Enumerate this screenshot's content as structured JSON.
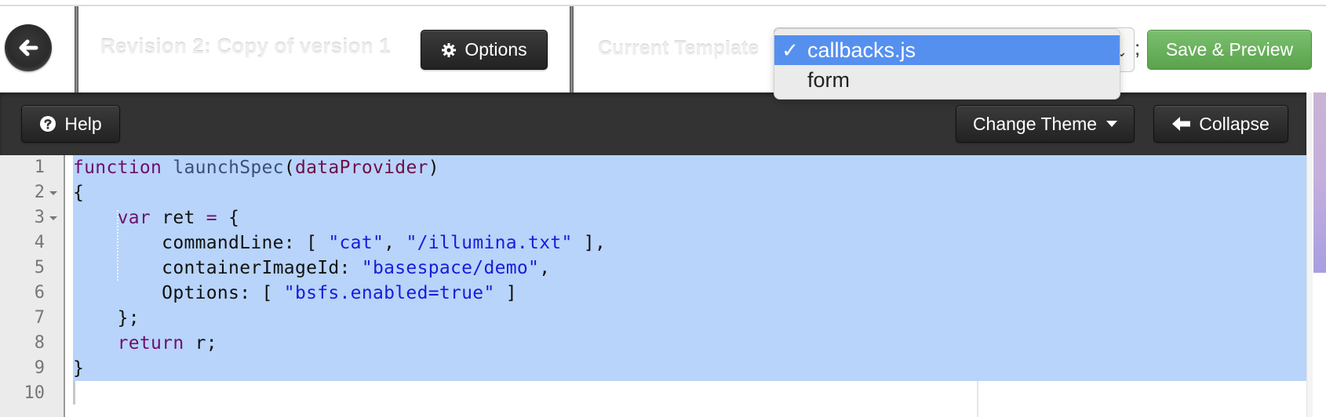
{
  "header": {
    "back_icon": "arrow-left-circle-icon",
    "title": "Revision 2: Copy of version 1",
    "options_label": "Options",
    "options_icon": "gear-icon",
    "template_label": "Current Template",
    "template_select": {
      "selected": "callbacks.js",
      "options": [
        "callbacks.js",
        "form"
      ],
      "check_glyph": "✓"
    },
    "separator": ";",
    "save_label": "Save & Preview"
  },
  "toolbar": {
    "help_label": "Help",
    "help_icon": "question-circle-icon",
    "theme_label": "Change Theme",
    "collapse_label": "Collapse",
    "collapse_icon": "arrow-left-icon"
  },
  "editor": {
    "line_numbers": [
      "1",
      "2",
      "3",
      "4",
      "5",
      "6",
      "7",
      "8",
      "9",
      "10"
    ],
    "foldable_lines": [
      2,
      3
    ],
    "selected_lines": "1-9",
    "lines": [
      [
        {
          "t": "kw",
          "v": "function"
        },
        {
          "t": "",
          "v": " "
        },
        {
          "t": "fn",
          "v": "launchSpec"
        },
        {
          "t": "",
          "v": "("
        },
        {
          "t": "param",
          "v": "dataProvider"
        },
        {
          "t": "",
          "v": ")"
        }
      ],
      [
        {
          "t": "",
          "v": "{"
        }
      ],
      [
        {
          "t": "",
          "v": "    "
        },
        {
          "t": "kw",
          "v": "var"
        },
        {
          "t": "",
          "v": " ret "
        },
        {
          "t": "op",
          "v": "="
        },
        {
          "t": "",
          "v": " {"
        }
      ],
      [
        {
          "t": "",
          "v": "        commandLine: [ "
        },
        {
          "t": "str",
          "v": "\"cat\""
        },
        {
          "t": "",
          "v": ", "
        },
        {
          "t": "str",
          "v": "\"/illumina.txt\""
        },
        {
          "t": "",
          "v": " ],"
        }
      ],
      [
        {
          "t": "",
          "v": "        containerImageId: "
        },
        {
          "t": "str",
          "v": "\"basespace/demo\""
        },
        {
          "t": "",
          "v": ","
        }
      ],
      [
        {
          "t": "",
          "v": "        Options: [ "
        },
        {
          "t": "str",
          "v": "\"bsfs.enabled=true\""
        },
        {
          "t": "",
          "v": " ]"
        }
      ],
      [
        {
          "t": "",
          "v": "    };"
        }
      ],
      [
        {
          "t": "",
          "v": "    "
        },
        {
          "t": "kw",
          "v": "return"
        },
        {
          "t": "",
          "v": " r;"
        }
      ],
      [
        {
          "t": "",
          "v": "}"
        }
      ],
      [
        {
          "t": "",
          "v": ""
        }
      ]
    ]
  },
  "colors": {
    "selection": "#b8d4fa",
    "save_button": "#5aa34c",
    "dropdown_highlight": "#5690ef",
    "toolbar": "#333333"
  }
}
